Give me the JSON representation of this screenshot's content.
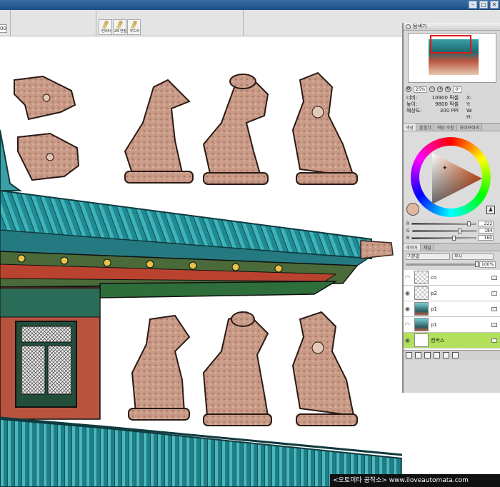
{
  "titlebar": {
    "min": "–",
    "max": "□",
    "close": "✕"
  },
  "toolbar": {
    "zoom_value": "00",
    "brush_tabs": [
      {
        "label": "컨버터"
      },
      {
        "label": "2B 연필"
      },
      {
        "label": "부드러"
      }
    ]
  },
  "navigator": {
    "title": "탐색기",
    "zoom": "25%",
    "rotation": "0°",
    "info": {
      "width_label": "너비:",
      "width_value": "10900 픽셀",
      "height_label": "높이:",
      "height_value": "9800 픽셀",
      "res_label": "해상도:",
      "res_value": "300 PPI",
      "x_label": "X:",
      "y_label": "Y:",
      "w_label": "W:",
      "h_label": "H:"
    }
  },
  "color_panel": {
    "tabs": [
      "색상",
      "혼합기",
      "색상 조합",
      "라이브러리"
    ],
    "current_color": "#E0B8A0",
    "R": {
      "label": "R",
      "value": "222"
    },
    "G": {
      "label": "G",
      "value": "184"
    },
    "B": {
      "label": "B",
      "value": "160"
    },
    "R_fraction": 0.87,
    "G_fraction": 0.72,
    "B_fraction": 0.63
  },
  "layers_panel": {
    "tabs": [
      "레이어",
      "채널"
    ],
    "blend_mode": "기본값",
    "preserve": "무시",
    "opacity": "100%",
    "layers": [
      {
        "name": "co",
        "thumb": "checker",
        "visible": false
      },
      {
        "name": "p2",
        "thumb": "checker",
        "visible": true
      },
      {
        "name": "p1",
        "thumb": "roof",
        "visible": true
      },
      {
        "name": "p1",
        "thumb": "roof",
        "visible": false
      },
      {
        "name": "캔버스",
        "thumb": "plain",
        "visible": true,
        "active": true
      }
    ]
  },
  "watermark": {
    "text": "<오토미타 공작소> www.iloveautomata.com"
  },
  "colors": {
    "accent_active_layer": "#B2E05A",
    "roof_teal": "#2F9AA0",
    "statue_clay": "#C99A86"
  }
}
